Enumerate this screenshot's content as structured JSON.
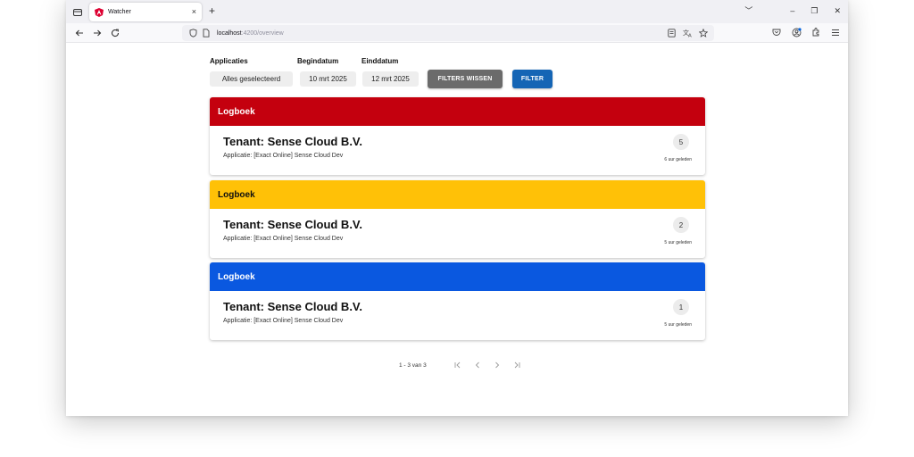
{
  "browser": {
    "tab_title": "Watcher",
    "tab_close": "×",
    "new_tab": "+",
    "url_host": "localhost",
    "url_path": ":4200/overview",
    "window_controls": [
      "﹀",
      "–",
      "❐",
      "✕"
    ]
  },
  "filters": {
    "applications_label": "Applicaties",
    "applications_value": "Alles geselecteerd",
    "start_label": "Begindatum",
    "start_value": "10 mrt 2025",
    "end_label": "Einddatum",
    "end_value": "12 mrt 2025",
    "clear_label": "FILTERS WISSEN",
    "filter_label": "FILTER"
  },
  "cards": [
    {
      "header": "Logboek",
      "color": "#c4000e",
      "text_color": "#ffffff",
      "tenant": "Tenant: Sense Cloud B.V.",
      "application": "Applicatie: [Exact Online] Sense Cloud Dev",
      "count": "5",
      "age": "6 uur geleden"
    },
    {
      "header": "Logboek",
      "color": "#ffc107",
      "text_color": "#111111",
      "tenant": "Tenant: Sense Cloud B.V.",
      "application": "Applicatie: [Exact Online] Sense Cloud Dev",
      "count": "2",
      "age": "5 uur geleden"
    },
    {
      "header": "Logboek",
      "color": "#0a58e0",
      "text_color": "#ffffff",
      "tenant": "Tenant: Sense Cloud B.V.",
      "application": "Applicatie: [Exact Online] Sense Cloud Dev",
      "count": "1",
      "age": "5 uur geleden"
    }
  ],
  "pagination": {
    "range_text": "1 - 3 van 3"
  },
  "icons": {
    "tab_manager": "tab-manager-icon",
    "favicon": "angular-logo-icon",
    "back": "arrow-left-icon",
    "forward": "arrow-right-icon",
    "reload": "reload-icon",
    "shield": "shield-icon",
    "page": "page-icon",
    "reader": "reader-view-icon",
    "translate": "translate-icon",
    "bookmark": "star-icon",
    "pocket": "pocket-icon",
    "account": "account-icon",
    "extensions": "extensions-icon",
    "menu": "hamburger-menu-icon"
  }
}
